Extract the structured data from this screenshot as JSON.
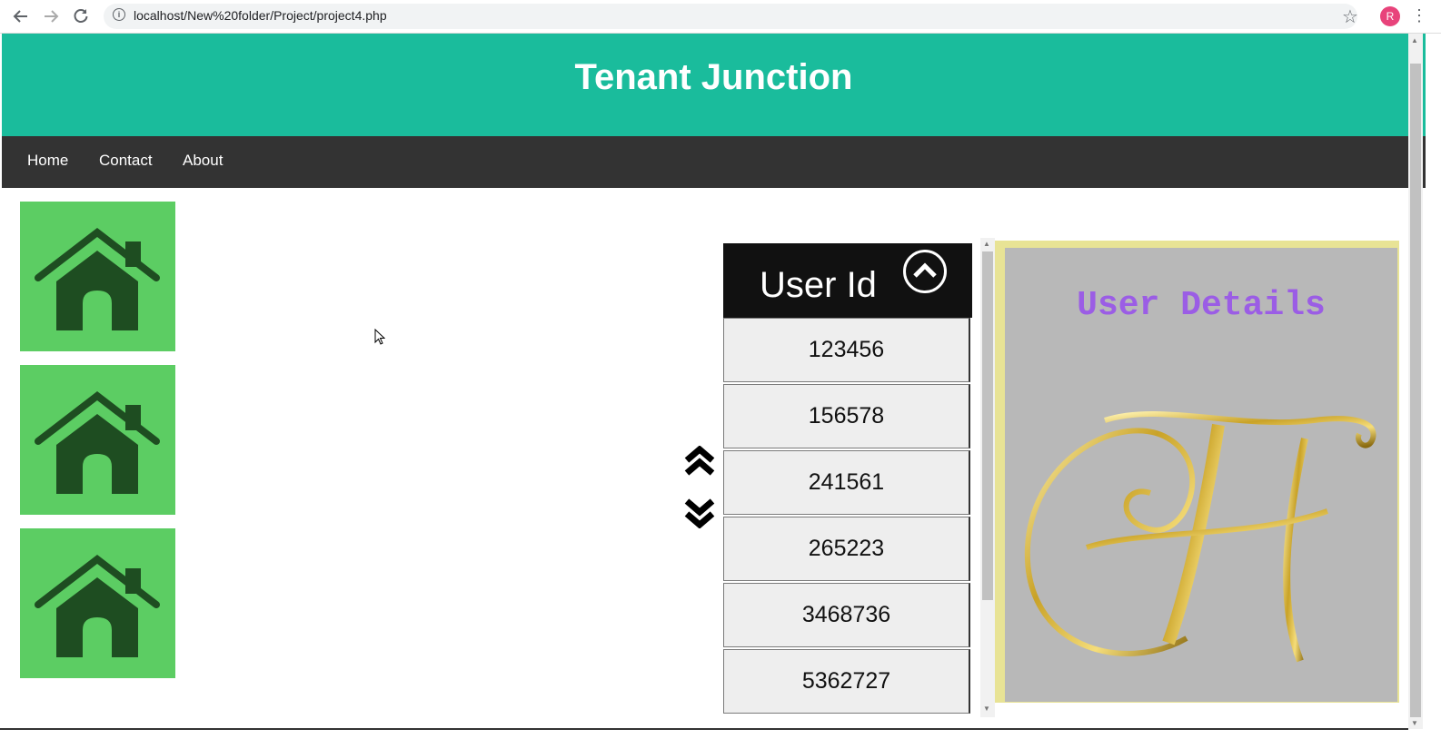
{
  "browser": {
    "url": "localhost/New%20folder/Project/project4.php",
    "avatar_letter": "R",
    "back_icon": "arrow-left-icon",
    "forward_icon": "arrow-right-icon",
    "reload_icon": "reload-icon"
  },
  "header": {
    "title": "Tenant Junction"
  },
  "nav": {
    "items": [
      "Home",
      "Contact",
      "About"
    ]
  },
  "house_icons": 3,
  "user_table": {
    "header": "User Id",
    "rows": [
      "123456",
      "156578",
      "241561",
      "265223",
      "3468736",
      "5362727"
    ]
  },
  "details": {
    "title": "User Details"
  },
  "colors": {
    "header_bg": "#1abc9c",
    "nav_bg": "#333333",
    "house_bg": "#5ccd63",
    "house_fg": "#1e4d21",
    "details_title": "#9b5de5",
    "details_border": "#e8e395",
    "details_bg": "#b8b8b8"
  }
}
